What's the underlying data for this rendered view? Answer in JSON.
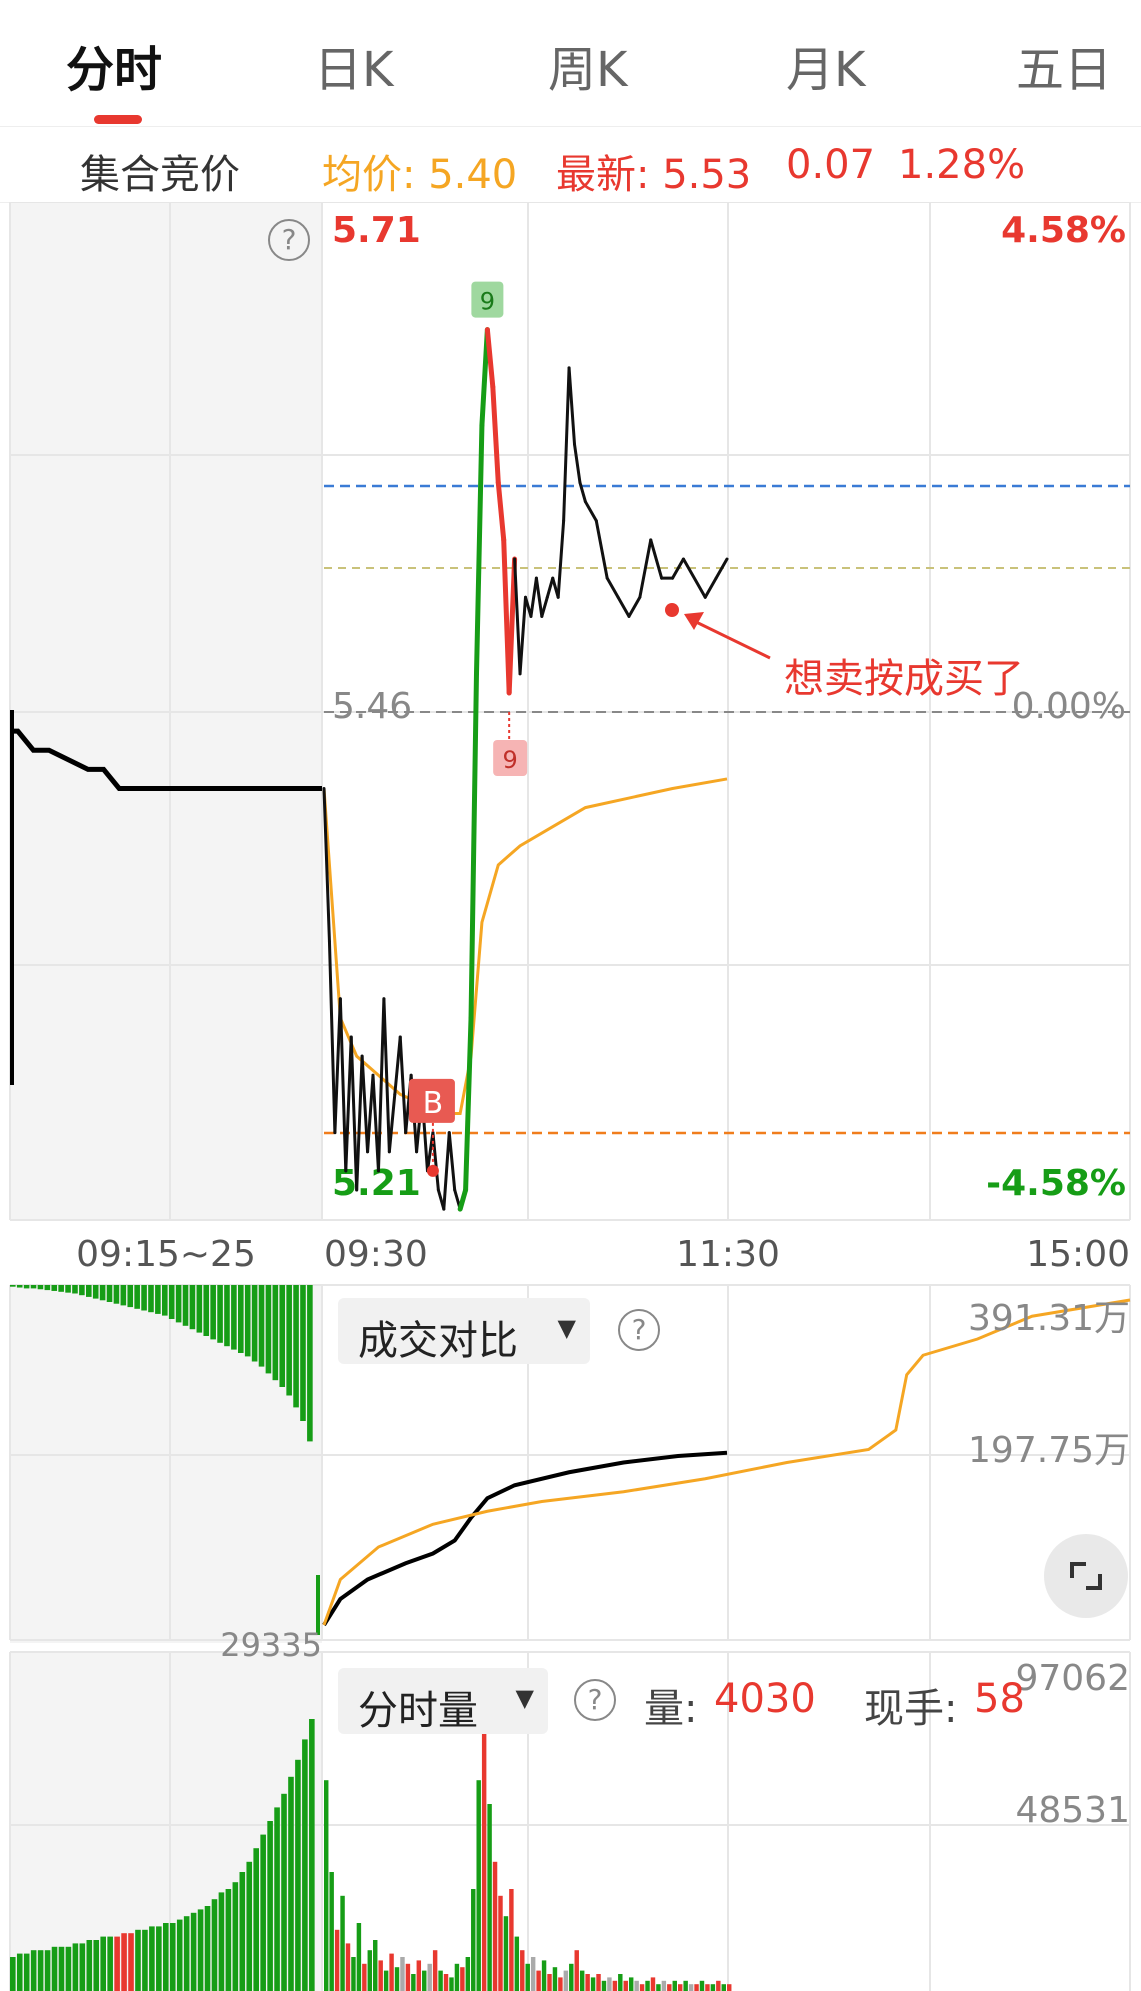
{
  "tabs": [
    {
      "label": "分时",
      "active": true
    },
    {
      "label": "日K",
      "active": false
    },
    {
      "label": "周K",
      "active": false
    },
    {
      "label": "月K",
      "active": false
    },
    {
      "label": "五日",
      "active": false
    }
  ],
  "infobar": {
    "auction_label": "集合竞价",
    "avg_price": "均价: 5.40",
    "latest": "最新: 5.53",
    "change": "0.07",
    "change_pct": "1.28%"
  },
  "colors": {
    "up": "#e8382f",
    "down": "#169d16",
    "avg_line": "#f5a623",
    "price_line": "#111111",
    "high_ref_line": "#3a7bd5",
    "low_ref_line": "#f07d1c"
  },
  "chart_data": {
    "type": "line",
    "price_axis": {
      "max_label": "5.71",
      "min_label": "5.21",
      "prev_close_label": "5.46",
      "max_pct": "4.58%",
      "min_pct": "-4.58%",
      "zero_pct": "0.00%",
      "range": [
        5.21,
        5.71
      ]
    },
    "time_ticks": [
      "09:15~25",
      "09:30",
      "11:30",
      "15:00"
    ],
    "annotation": "想卖按成买了",
    "markers": [
      {
        "label": "9",
        "kind": "top",
        "t": 30,
        "price": 5.66
      },
      {
        "label": "9",
        "kind": "bottom",
        "t": 34,
        "price": 5.46
      },
      {
        "label": "B",
        "kind": "buy",
        "t": 20,
        "price": 5.22
      }
    ],
    "auction_price": [
      [
        0,
        5.45
      ],
      [
        1,
        5.45
      ],
      [
        3,
        5.44
      ],
      [
        5,
        5.44
      ],
      [
        10,
        5.43
      ],
      [
        12,
        5.43
      ],
      [
        14,
        5.42
      ],
      [
        40,
        5.42
      ]
    ],
    "price": [
      [
        0,
        5.42
      ],
      [
        1,
        5.34
      ],
      [
        2,
        5.24
      ],
      [
        3,
        5.31
      ],
      [
        4,
        5.22
      ],
      [
        5,
        5.29
      ],
      [
        6,
        5.21
      ],
      [
        7,
        5.28
      ],
      [
        8,
        5.23
      ],
      [
        9,
        5.27
      ],
      [
        10,
        5.22
      ],
      [
        11,
        5.31
      ],
      [
        12,
        5.23
      ],
      [
        13,
        5.26
      ],
      [
        14,
        5.29
      ],
      [
        15,
        5.24
      ],
      [
        16,
        5.27
      ],
      [
        17,
        5.23
      ],
      [
        18,
        5.26
      ],
      [
        19,
        5.22
      ],
      [
        20,
        5.24
      ],
      [
        21,
        5.21
      ],
      [
        22,
        5.2
      ],
      [
        23,
        5.24
      ],
      [
        24,
        5.21
      ],
      [
        25,
        5.2
      ],
      [
        26,
        5.21
      ],
      [
        27,
        5.3
      ],
      [
        28,
        5.48
      ],
      [
        29,
        5.61
      ],
      [
        30,
        5.66
      ],
      [
        31,
        5.63
      ],
      [
        32,
        5.58
      ],
      [
        33,
        5.55
      ],
      [
        34,
        5.47
      ],
      [
        35,
        5.54
      ],
      [
        36,
        5.48
      ],
      [
        37,
        5.52
      ],
      [
        38,
        5.51
      ],
      [
        39,
        5.53
      ],
      [
        40,
        5.51
      ],
      [
        41,
        5.52
      ],
      [
        42,
        5.53
      ],
      [
        43,
        5.52
      ],
      [
        44,
        5.56
      ],
      [
        45,
        5.64
      ],
      [
        46,
        5.6
      ],
      [
        47,
        5.58
      ],
      [
        48,
        5.57
      ],
      [
        50,
        5.56
      ],
      [
        52,
        5.53
      ],
      [
        54,
        5.52
      ],
      [
        56,
        5.51
      ],
      [
        58,
        5.52
      ],
      [
        60,
        5.55
      ],
      [
        62,
        5.53
      ],
      [
        64,
        5.53
      ],
      [
        66,
        5.54
      ],
      [
        70,
        5.52
      ],
      [
        72,
        5.53
      ],
      [
        74,
        5.54
      ]
    ],
    "avg_price": [
      [
        0,
        5.42
      ],
      [
        3,
        5.3
      ],
      [
        6,
        5.28
      ],
      [
        10,
        5.27
      ],
      [
        14,
        5.26
      ],
      [
        18,
        5.255
      ],
      [
        20,
        5.25
      ],
      [
        23,
        5.25
      ],
      [
        25,
        5.25
      ],
      [
        27,
        5.28
      ],
      [
        29,
        5.35
      ],
      [
        32,
        5.38
      ],
      [
        36,
        5.39
      ],
      [
        42,
        5.4
      ],
      [
        48,
        5.41
      ],
      [
        56,
        5.415
      ],
      [
        64,
        5.42
      ],
      [
        74,
        5.425
      ]
    ],
    "compare": {
      "title": "成交对比",
      "labels": [
        "391.31万",
        "197.75万",
        "29335"
      ],
      "today_cum": [
        [
          0,
          0.0
        ],
        [
          3,
          0.08
        ],
        [
          8,
          0.14
        ],
        [
          15,
          0.19
        ],
        [
          20,
          0.22
        ],
        [
          24,
          0.26
        ],
        [
          27,
          0.33
        ],
        [
          30,
          0.39
        ],
        [
          35,
          0.43
        ],
        [
          45,
          0.47
        ],
        [
          55,
          0.5
        ],
        [
          65,
          0.52
        ],
        [
          74,
          0.53
        ]
      ],
      "prev_cum": [
        [
          0,
          0.0
        ],
        [
          3,
          0.14
        ],
        [
          10,
          0.24
        ],
        [
          20,
          0.31
        ],
        [
          30,
          0.35
        ],
        [
          40,
          0.38
        ],
        [
          55,
          0.41
        ],
        [
          70,
          0.45
        ],
        [
          85,
          0.5
        ],
        [
          100,
          0.54
        ],
        [
          105,
          0.6
        ],
        [
          107,
          0.77
        ],
        [
          110,
          0.83
        ],
        [
          120,
          0.88
        ],
        [
          130,
          0.95
        ],
        [
          148,
          1.0
        ]
      ],
      "auction_volume": [
        0.01,
        0.015,
        0.02,
        0.02,
        0.025,
        0.03,
        0.035,
        0.04,
        0.045,
        0.05,
        0.06,
        0.07,
        0.08,
        0.09,
        0.1,
        0.11,
        0.12,
        0.13,
        0.14,
        0.15,
        0.16,
        0.17,
        0.18,
        0.2,
        0.22,
        0.24,
        0.26,
        0.28,
        0.3,
        0.32,
        0.34,
        0.36,
        0.38,
        0.4,
        0.42,
        0.45,
        0.48,
        0.52,
        0.56,
        0.6,
        0.65,
        0.72,
        0.8,
        0.92
      ]
    },
    "volume": {
      "title": "分时量",
      "vol_label": "量:",
      "vol_value": "4030",
      "hand_label": "现手:",
      "hand_value": "58",
      "max_label": "97062",
      "mid_label": "48531",
      "auction_volume": [
        0.1,
        0.11,
        0.11,
        0.12,
        0.12,
        0.12,
        0.13,
        0.13,
        0.13,
        0.14,
        0.14,
        0.15,
        0.15,
        0.16,
        0.16,
        0.16,
        0.17,
        0.17,
        0.18,
        0.18,
        0.19,
        0.19,
        0.2,
        0.2,
        0.21,
        0.22,
        0.23,
        0.24,
        0.25,
        0.27,
        0.29,
        0.3,
        0.32,
        0.35,
        0.38,
        0.42,
        0.46,
        0.5,
        0.54,
        0.58,
        0.63,
        0.68,
        0.74,
        0.8
      ],
      "bars": [
        [
          0.62,
          "down"
        ],
        [
          0.35,
          "down"
        ],
        [
          0.18,
          "up"
        ],
        [
          0.28,
          "down"
        ],
        [
          0.14,
          "up"
        ],
        [
          0.1,
          "down"
        ],
        [
          0.2,
          "down"
        ],
        [
          0.08,
          "up"
        ],
        [
          0.12,
          "down"
        ],
        [
          0.15,
          "down"
        ],
        [
          0.09,
          "up"
        ],
        [
          0.06,
          "down"
        ],
        [
          0.11,
          "up"
        ],
        [
          0.07,
          "down"
        ],
        [
          0.1,
          "gray"
        ],
        [
          0.08,
          "up"
        ],
        [
          0.05,
          "down"
        ],
        [
          0.09,
          "up"
        ],
        [
          0.06,
          "down"
        ],
        [
          0.08,
          "gray"
        ],
        [
          0.12,
          "up"
        ],
        [
          0.06,
          "down"
        ],
        [
          0.05,
          "up"
        ],
        [
          0.04,
          "down"
        ],
        [
          0.08,
          "down"
        ],
        [
          0.07,
          "up"
        ],
        [
          0.1,
          "down"
        ],
        [
          0.3,
          "down"
        ],
        [
          0.62,
          "down"
        ],
        [
          0.8,
          "up"
        ],
        [
          0.55,
          "down"
        ],
        [
          0.38,
          "up"
        ],
        [
          0.28,
          "up"
        ],
        [
          0.22,
          "down"
        ],
        [
          0.3,
          "up"
        ],
        [
          0.16,
          "down"
        ],
        [
          0.12,
          "up"
        ],
        [
          0.08,
          "down"
        ],
        [
          0.1,
          "gray"
        ],
        [
          0.06,
          "up"
        ],
        [
          0.09,
          "down"
        ],
        [
          0.05,
          "up"
        ],
        [
          0.07,
          "down"
        ],
        [
          0.04,
          "up"
        ],
        [
          0.06,
          "gray"
        ],
        [
          0.08,
          "down"
        ],
        [
          0.12,
          "up"
        ],
        [
          0.06,
          "down"
        ],
        [
          0.05,
          "up"
        ],
        [
          0.04,
          "down"
        ],
        [
          0.05,
          "up"
        ],
        [
          0.03,
          "down"
        ],
        [
          0.04,
          "gray"
        ],
        [
          0.03,
          "up"
        ],
        [
          0.05,
          "down"
        ],
        [
          0.03,
          "up"
        ],
        [
          0.04,
          "down"
        ],
        [
          0.03,
          "gray"
        ],
        [
          0.02,
          "up"
        ],
        [
          0.03,
          "down"
        ],
        [
          0.04,
          "up"
        ],
        [
          0.02,
          "down"
        ],
        [
          0.03,
          "gray"
        ],
        [
          0.02,
          "up"
        ],
        [
          0.03,
          "down"
        ],
        [
          0.02,
          "up"
        ],
        [
          0.03,
          "down"
        ],
        [
          0.02,
          "gray"
        ],
        [
          0.02,
          "up"
        ],
        [
          0.03,
          "down"
        ],
        [
          0.02,
          "up"
        ],
        [
          0.02,
          "down"
        ],
        [
          0.03,
          "up"
        ],
        [
          0.02,
          "down"
        ],
        [
          0.02,
          "up"
        ]
      ]
    }
  }
}
